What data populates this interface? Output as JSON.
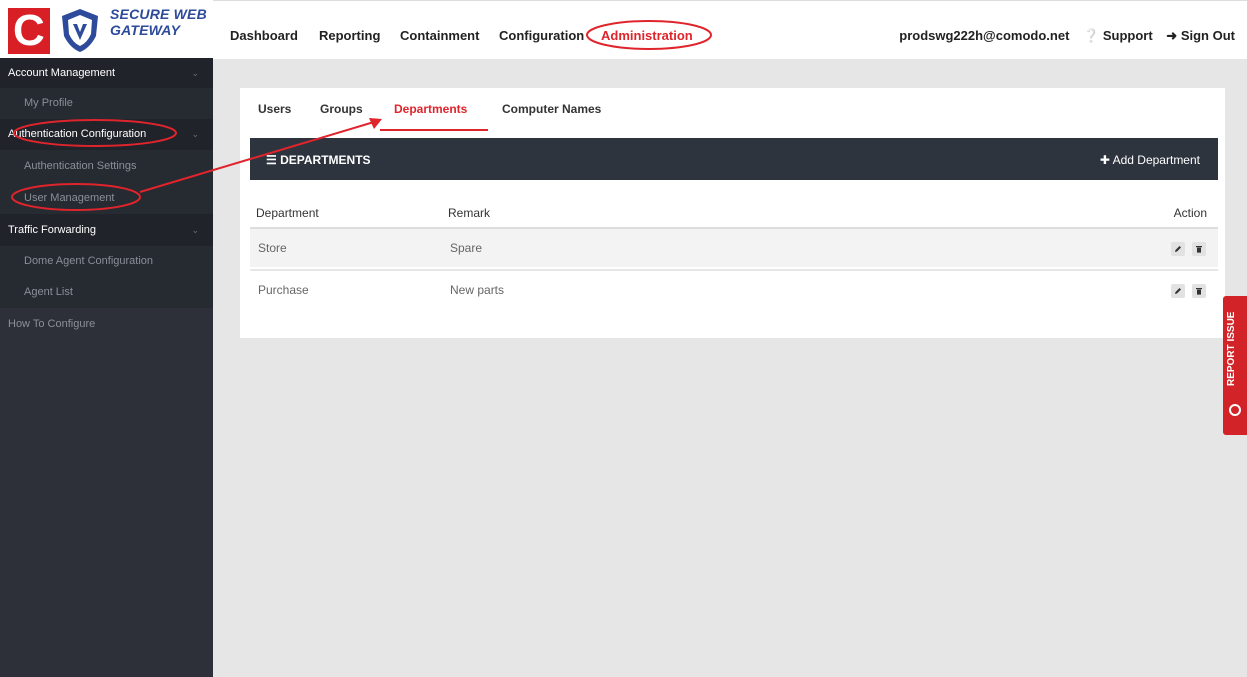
{
  "logo": {
    "brand_line1": "SECURE WEB",
    "brand_line2": "GATEWAY"
  },
  "nav": [
    "Dashboard",
    "Reporting",
    "Containment",
    "Configuration",
    "Administration"
  ],
  "user": {
    "email": "prodswg222h@comodo.net",
    "support": "Support",
    "signout": "Sign Out"
  },
  "sidebar": [
    {
      "label": "Account Management",
      "kind": "head"
    },
    {
      "label": "My Profile",
      "kind": "sub"
    },
    {
      "label": "Authentication Configuration",
      "kind": "head"
    },
    {
      "label": "Authentication Settings",
      "kind": "sub"
    },
    {
      "label": "User Management",
      "kind": "sub"
    },
    {
      "label": "Traffic Forwarding",
      "kind": "head"
    },
    {
      "label": "Dome Agent Configuration",
      "kind": "sub"
    },
    {
      "label": "Agent List",
      "kind": "sub"
    },
    {
      "label": "How To Configure",
      "kind": "plain"
    }
  ],
  "tabs": [
    "Users",
    "Groups",
    "Departments",
    "Computer Names"
  ],
  "panel": {
    "title": "DEPARTMENTS",
    "add_label": "Add Department"
  },
  "table": {
    "headers": [
      "Department",
      "Remark",
      "Action"
    ],
    "rows": [
      {
        "department": "Store",
        "remark": "Spare"
      },
      {
        "department": "Purchase",
        "remark": "New parts"
      }
    ]
  },
  "report_issue": "REPORT ISSUE",
  "colors": {
    "accent": "#e0242c",
    "sidebar": "#2d3038",
    "panel_header": "#2d343e"
  }
}
